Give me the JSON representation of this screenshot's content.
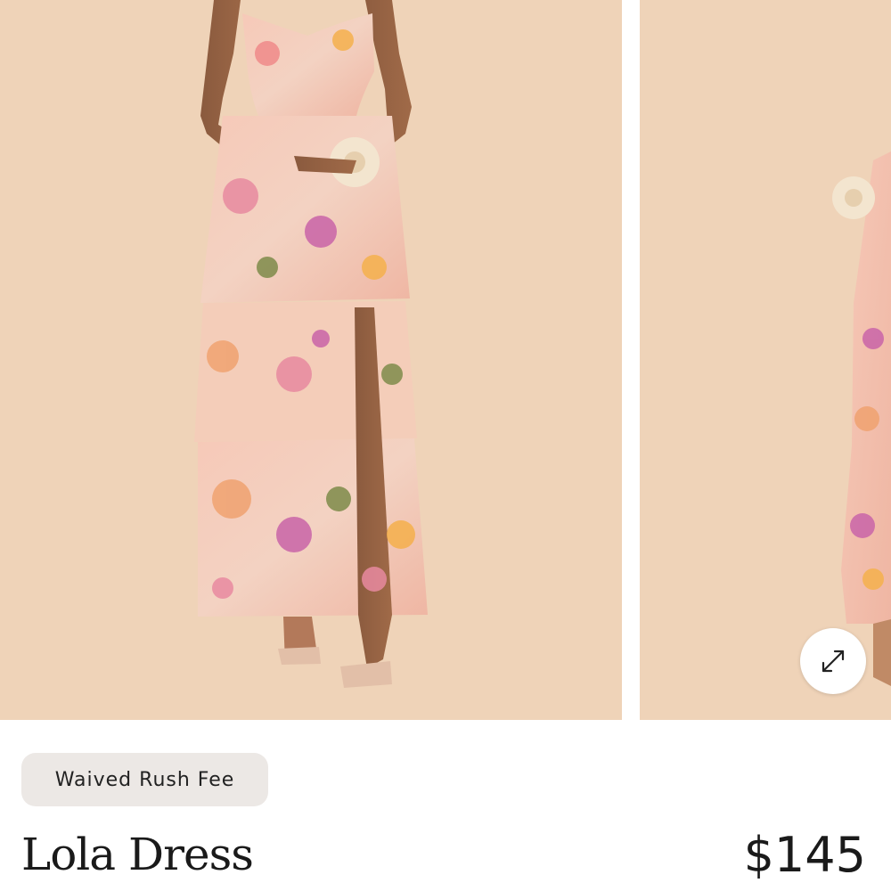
{
  "product": {
    "badge": "Waived Rush Fee",
    "name": "Lola Dress",
    "price": "$145"
  },
  "gallery": {
    "images": [
      {
        "alt": "Model wearing floral tiered maxi dress, front view"
      },
      {
        "alt": "Model wearing floral tiered maxi dress, side view"
      }
    ],
    "expand_icon": "expand-arrows-icon"
  },
  "colors": {
    "backdrop": "#efd3b8",
    "badge_bg": "#ece8e5",
    "text": "#1a1a1a"
  }
}
